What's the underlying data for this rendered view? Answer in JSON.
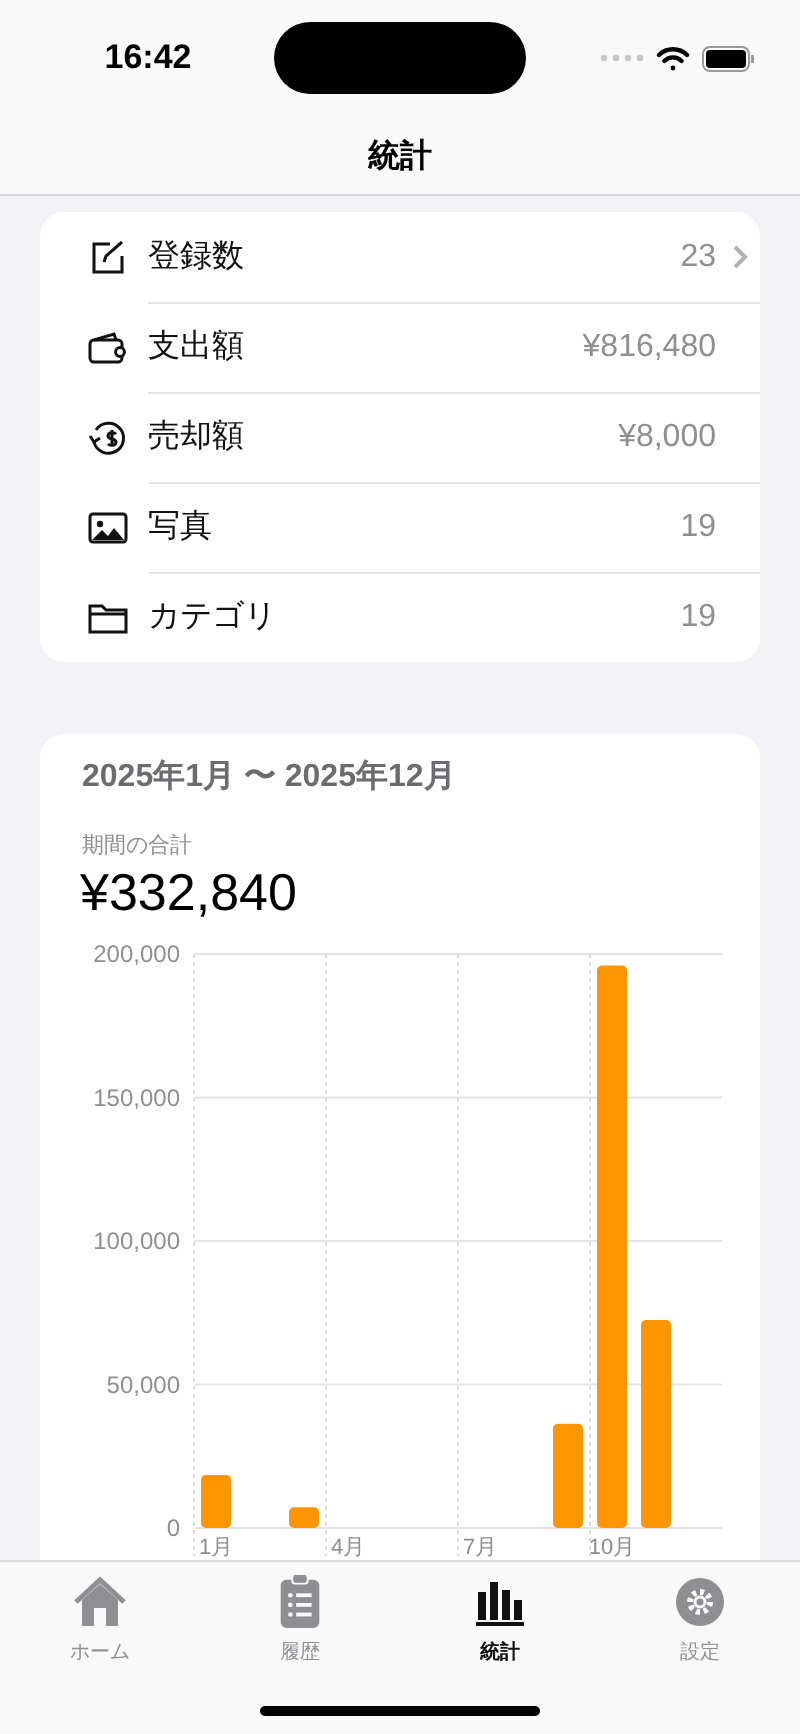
{
  "status_bar": {
    "time": "16:42"
  },
  "nav": {
    "title": "統計"
  },
  "summary": [
    {
      "kind": "edit",
      "label": "登録数",
      "value": "23",
      "chevron": true
    },
    {
      "kind": "wallet",
      "label": "支出額",
      "value": "¥816,480",
      "chevron": false
    },
    {
      "kind": "sale",
      "label": "売却額",
      "value": "¥8,000",
      "chevron": false
    },
    {
      "kind": "photo",
      "label": "写真",
      "value": "19",
      "chevron": false
    },
    {
      "kind": "folder",
      "label": "カテゴリ",
      "value": "19",
      "chevron": false
    }
  ],
  "period": {
    "range": "2025年1月 〜 2025年12月",
    "total_label": "期間の合計",
    "total": "¥332,840",
    "chart_data": {
      "type": "bar",
      "grid": true,
      "x": [
        1,
        3,
        9,
        10,
        11
      ],
      "values": [
        18500,
        7200,
        36300,
        196000,
        72500
      ],
      "xlim": [
        0.5,
        12.5
      ],
      "ylim": [
        0,
        200000
      ],
      "yticks": [
        {
          "value": 0,
          "label": "0"
        },
        {
          "value": 50000,
          "label": "50,000"
        },
        {
          "value": 100000,
          "label": "100,000"
        },
        {
          "value": 150000,
          "label": "150,000"
        },
        {
          "value": 200000,
          "label": "200,000"
        }
      ],
      "xticks": [
        {
          "value": 1,
          "label": "1月"
        },
        {
          "value": 4,
          "label": "4月"
        },
        {
          "value": 7,
          "label": "7月"
        },
        {
          "value": 10,
          "label": "10月"
        }
      ]
    }
  },
  "tabs": [
    {
      "kind": "home",
      "label": "ホーム",
      "selected": false
    },
    {
      "kind": "history",
      "label": "履歴",
      "selected": false
    },
    {
      "kind": "stats",
      "label": "統計",
      "selected": true
    },
    {
      "kind": "settings",
      "label": "設定",
      "selected": false
    }
  ]
}
